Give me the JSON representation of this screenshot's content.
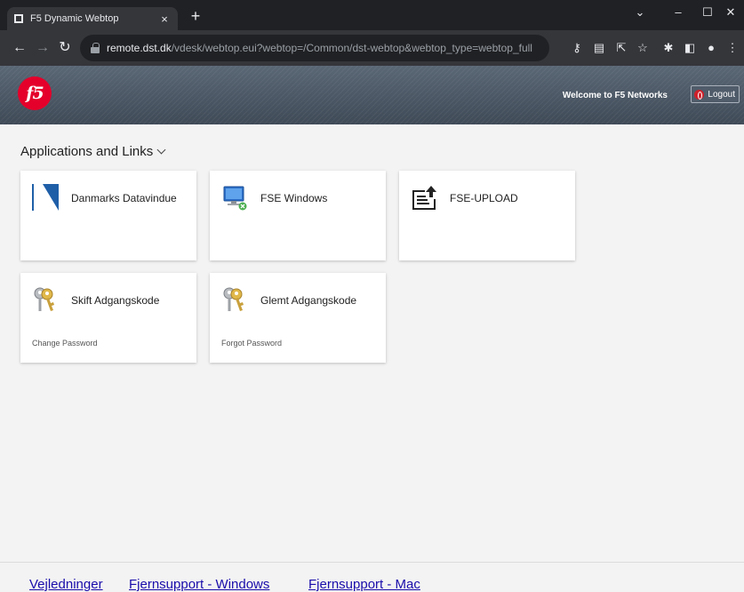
{
  "browser": {
    "tab_title": "F5 Dynamic Webtop",
    "tab_close": "×",
    "new_tab": "+",
    "url_host": "remote.dst.dk",
    "url_path": "/vdesk/webtop.eui?webtop=/Common/dst-webtop&webtop_type=webtop_full"
  },
  "header": {
    "logo_text": "f5",
    "welcome": "Welcome to F5 Networks",
    "logout_label": "Logout"
  },
  "section": {
    "title": "Applications and Links"
  },
  "cards": [
    {
      "title": "Danmarks Datavindue",
      "subtitle": "",
      "icon": "datavindue-icon"
    },
    {
      "title": "FSE Windows",
      "subtitle": "",
      "icon": "remote-desktop-icon"
    },
    {
      "title": "FSE-UPLOAD",
      "subtitle": "",
      "icon": "upload-icon"
    },
    {
      "title": "Skift Adgangskode",
      "subtitle": "Change Password",
      "icon": "keys-icon"
    },
    {
      "title": "Glemt Adgangskode",
      "subtitle": "Forgot Password",
      "icon": "keys-icon"
    }
  ],
  "footer": {
    "links": [
      "Vejledninger",
      "Fjernsupport - Windows",
      "Fjernsupport - Mac"
    ]
  },
  "colors": {
    "f5_red": "#e4002b",
    "link": "#1a0dab",
    "header_bg": "#4f5b69"
  }
}
